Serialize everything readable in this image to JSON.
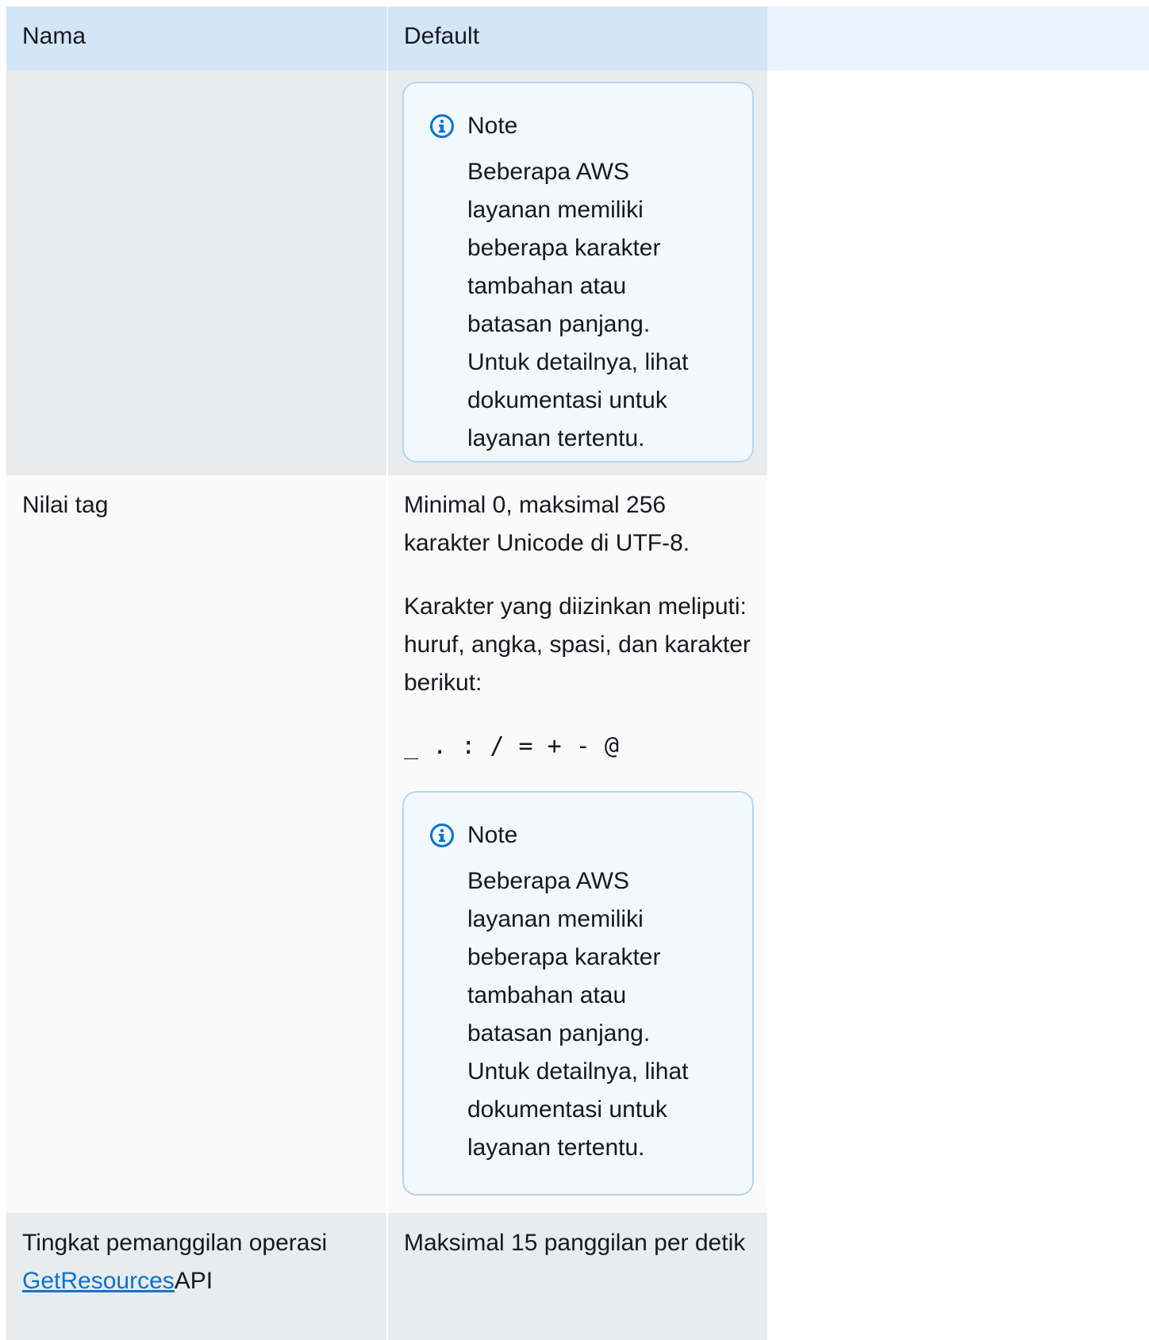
{
  "table": {
    "headers": [
      "Nama",
      "Default"
    ],
    "rows": [
      {
        "note": {
          "title": "Note",
          "lines": [
            "Beberapa AWS",
            "layanan memiliki",
            "beberapa karakter",
            "tambahan atau",
            "batasan panjang.",
            "Untuk detailnya, lihat",
            "dokumentasi untuk",
            "layanan tertentu."
          ]
        }
      },
      {
        "name": "Nilai tag",
        "para1": "Minimal 0, maksimal 256 karakter Unicode di UTF-8.",
        "para2": "Karakter yang diizinkan meliputi: huruf, angka, spasi, dan karakter berikut:",
        "chars": "_ . : / = + - @",
        "note": {
          "title": "Note",
          "lines": [
            "Beberapa AWS",
            "layanan memiliki",
            "beberapa karakter",
            "tambahan atau",
            "batasan panjang.",
            "Untuk detailnya, lihat",
            "dokumentasi untuk",
            "layanan tertentu."
          ]
        }
      },
      {
        "name_prefix": "Tingkat pemanggilan operasi",
        "name_link": "GetResources",
        "name_suffix": "API",
        "value": "Maksimal 15 panggilan per detik"
      }
    ]
  },
  "colors": {
    "header_bg": "#d2e6f7",
    "note_border": "#b4d6f4",
    "note_bg": "#f1f8fe",
    "icon": "#0972d3",
    "link": "#0972d3"
  },
  "icons": {
    "note_icon": "info-circle-icon"
  }
}
